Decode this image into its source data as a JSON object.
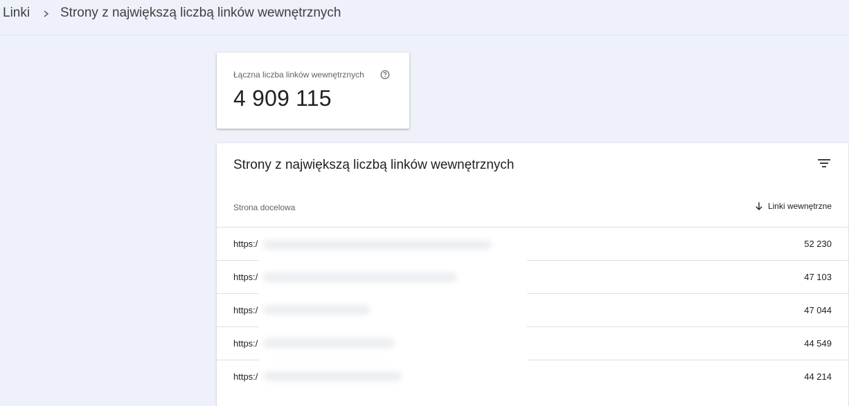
{
  "breadcrumb": {
    "root": "Linki",
    "current": "Strony z największą liczbą linków wewnętrznych"
  },
  "summary": {
    "label": "Łączna liczba linków wewnętrznych",
    "value": "4 909 115",
    "help_icon": "help-circle-icon"
  },
  "table": {
    "title": "Strony z największą liczbą linków wewnętrznych",
    "filter_icon": "filter-icon",
    "columns": {
      "target_page": "Strona docelowa",
      "internal_links": "Linki wewnętrzne",
      "sort_icon": "arrow-down-icon"
    },
    "rows": [
      {
        "url": "https:/",
        "value": "52 230"
      },
      {
        "url": "https:/",
        "value": "47 103"
      },
      {
        "url": "https:/",
        "value": "47 044"
      },
      {
        "url": "https:/",
        "value": "44 549"
      },
      {
        "url": "https:/",
        "value": "44 214"
      }
    ]
  },
  "colors": {
    "background": "#eef1f9",
    "card": "#ffffff",
    "text": "#202124",
    "muted": "#5f6368"
  }
}
